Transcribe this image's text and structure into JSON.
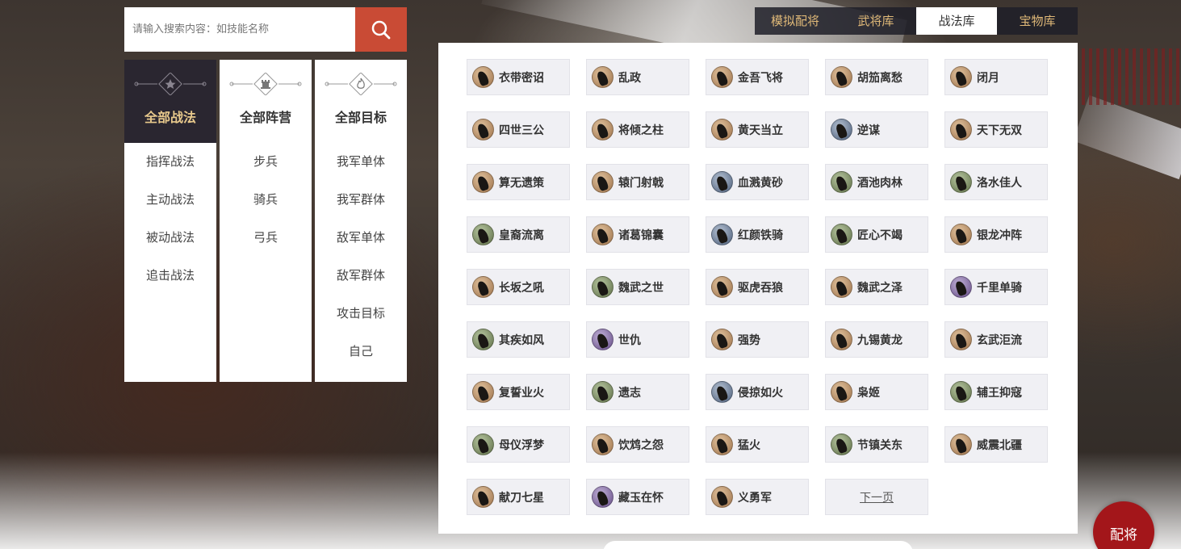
{
  "search": {
    "placeholder": "请输入搜索内容：如技能名称",
    "button_icon": "search-icon"
  },
  "tabs": [
    {
      "label": "模拟配将",
      "active": false
    },
    {
      "label": "武将库",
      "active": false
    },
    {
      "label": "战法库",
      "active": true
    },
    {
      "label": "宝物库",
      "active": false
    }
  ],
  "filters": {
    "types": {
      "title": "全部战法",
      "emblem": "star-icon",
      "items": [
        "指挥战法",
        "主动战法",
        "被动战法",
        "追击战法"
      ]
    },
    "camps": {
      "title": "全部阵营",
      "emblem": "rook-icon",
      "items": [
        "步兵",
        "骑兵",
        "弓兵"
      ]
    },
    "targets": {
      "title": "全部目标",
      "emblem": "flame-icon",
      "items": [
        "我军单体",
        "我军群体",
        "敌军单体",
        "敌军群体",
        "攻击目标",
        "自己"
      ]
    }
  },
  "skills": [
    {
      "name": "衣带密诏",
      "icon": "brown"
    },
    {
      "name": "乱政",
      "icon": "brown"
    },
    {
      "name": "金吾飞将",
      "icon": "brown"
    },
    {
      "name": "胡笳离愁",
      "icon": "brown"
    },
    {
      "name": "闭月",
      "icon": "brown"
    },
    {
      "name": "四世三公",
      "icon": "brown"
    },
    {
      "name": "将倾之柱",
      "icon": "brown"
    },
    {
      "name": "黄天当立",
      "icon": "brown"
    },
    {
      "name": "逆谋",
      "icon": "blue"
    },
    {
      "name": "天下无双",
      "icon": "brown"
    },
    {
      "name": "算无遗策",
      "icon": "brown"
    },
    {
      "name": "辕门射戟",
      "icon": "brown"
    },
    {
      "name": "血溅黄砂",
      "icon": "blue"
    },
    {
      "name": "酒池肉林",
      "icon": "green"
    },
    {
      "name": "洛水佳人",
      "icon": "green"
    },
    {
      "name": "皇裔流离",
      "icon": "green"
    },
    {
      "name": "诸葛锦囊",
      "icon": "brown"
    },
    {
      "name": "红颜铁骑",
      "icon": "blue"
    },
    {
      "name": "匠心不竭",
      "icon": "green"
    },
    {
      "name": "银龙冲阵",
      "icon": "brown"
    },
    {
      "name": "长坂之吼",
      "icon": "brown"
    },
    {
      "name": "魏武之世",
      "icon": "green"
    },
    {
      "name": "驱虎吞狼",
      "icon": "brown"
    },
    {
      "name": "魏武之泽",
      "icon": "brown"
    },
    {
      "name": "千里单骑",
      "icon": "purple"
    },
    {
      "name": "其疾如风",
      "icon": "green"
    },
    {
      "name": "世仇",
      "icon": "purple"
    },
    {
      "name": "强势",
      "icon": "brown"
    },
    {
      "name": "九锡黄龙",
      "icon": "brown"
    },
    {
      "name": "玄武洰流",
      "icon": "brown"
    },
    {
      "name": "复誓业火",
      "icon": "brown"
    },
    {
      "name": "遗志",
      "icon": "green"
    },
    {
      "name": "侵掠如火",
      "icon": "blue"
    },
    {
      "name": "枭姬",
      "icon": "brown"
    },
    {
      "name": "辅王抑寇",
      "icon": "green"
    },
    {
      "name": "母仪浮梦",
      "icon": "green"
    },
    {
      "name": "饮鸩之怨",
      "icon": "brown"
    },
    {
      "name": "猛火",
      "icon": "brown"
    },
    {
      "name": "节镇关东",
      "icon": "green"
    },
    {
      "name": "威震北疆",
      "icon": "brown"
    },
    {
      "name": "献刀七星",
      "icon": "brown"
    },
    {
      "name": "藏玉在怀",
      "icon": "purple"
    },
    {
      "name": "义勇军",
      "icon": "brown"
    }
  ],
  "pagination": {
    "next_label": "下一页"
  },
  "build_button": {
    "label": "配将"
  }
}
